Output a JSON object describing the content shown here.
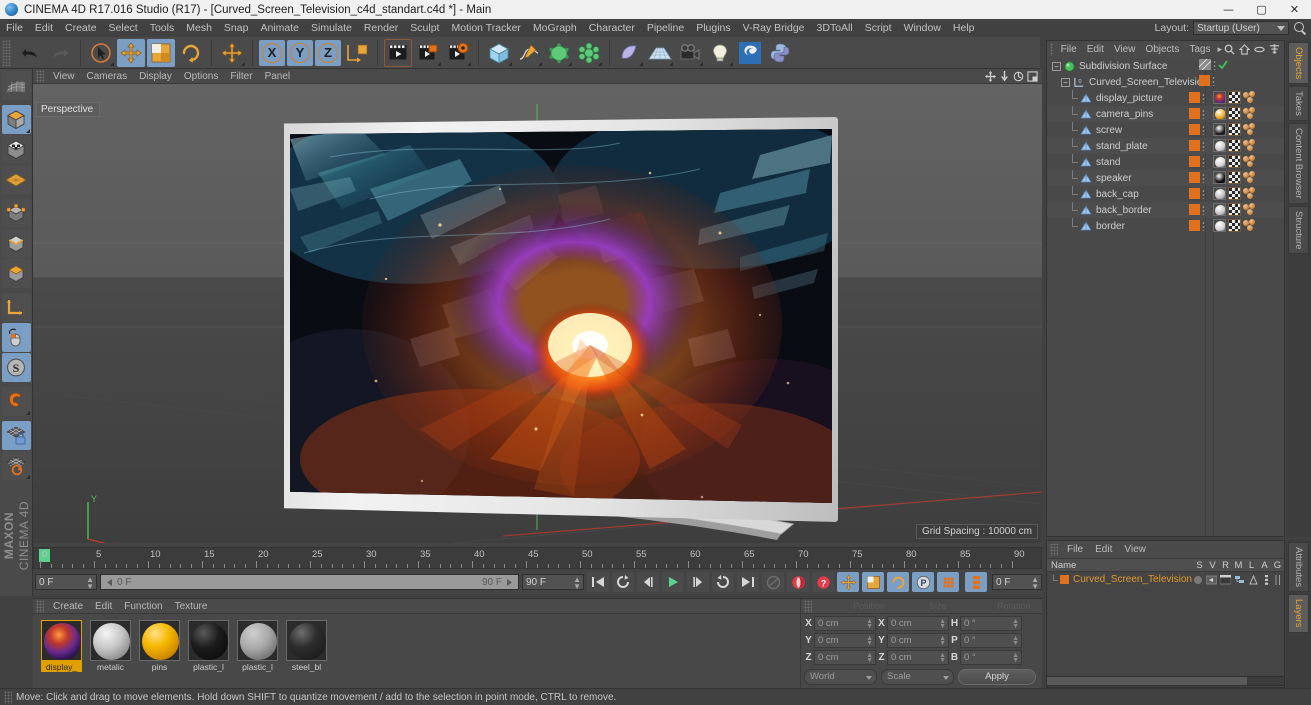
{
  "window": {
    "title": "CINEMA 4D R17.016 Studio (R17) - [Curved_Screen_Television_c4d_standart.c4d *] - Main",
    "minimize": "—",
    "maximize": "▢",
    "close": "✕"
  },
  "menubar": {
    "items": [
      "File",
      "Edit",
      "Create",
      "Select",
      "Tools",
      "Mesh",
      "Snap",
      "Animate",
      "Simulate",
      "Render",
      "Sculpt",
      "Motion Tracker",
      "MoGraph",
      "Character",
      "Pipeline",
      "Plugins",
      "V-Ray Bridge",
      "3DToAll",
      "Script",
      "Window",
      "Help"
    ],
    "layout_label": "Layout:",
    "layout_value": "Startup (User)"
  },
  "toolbar": {
    "undo": "Undo",
    "redo": "Redo",
    "live_selection": "Live Selection",
    "move": "Move",
    "scale": "Scale",
    "rotate": "Rotate",
    "move_plus": "Move Axis",
    "axis_x": "X",
    "axis_y": "Y",
    "axis_z": "Z",
    "world_coord": "World / Object Coordinate System",
    "render_view": "Render View",
    "render_region": "Render to Picture Viewer",
    "render_settings": "Edit Render Settings",
    "cube": "Add Cube Object",
    "spline": "Add Spline",
    "array": "Add Array Object",
    "mograph": "MoGraph Cloner",
    "deformer": "Add Bend Deformer",
    "floor": "Add Floor / Environment",
    "camera": "Add Camera",
    "light": "Add Light",
    "content_browser": "Content Browser",
    "python": "Script Manager"
  },
  "left_palette": {
    "items": [
      {
        "name": "make-editable-icon",
        "label": "Make Editable"
      },
      {
        "name": "model-mode-icon",
        "label": "Model Mode",
        "selected": true
      },
      {
        "name": "texture-mode-icon",
        "label": "Texture Mode"
      },
      {
        "name": "workplane-icon",
        "label": "Workplane"
      },
      {
        "name": "points-mode-icon",
        "label": "Points"
      },
      {
        "name": "edges-mode-icon",
        "label": "Edges"
      },
      {
        "name": "polygons-mode-icon",
        "label": "Polygons"
      },
      {
        "name": "object-axis-icon",
        "label": "Enable Axis Modification"
      },
      {
        "name": "viewport-solo-icon",
        "label": "Enable Snapping"
      },
      {
        "name": "soft-selection-icon",
        "label": "Soft Selection"
      },
      {
        "name": "magnet-icon",
        "label": "Magnet Tool"
      },
      {
        "name": "lock-workplane-icon",
        "label": "Lock Workplane",
        "selected": true
      },
      {
        "name": "planar-workplane-icon",
        "label": "Workplane Rotate"
      }
    ],
    "brand_line1": "MAXON",
    "brand_line2": "CINEMA 4D"
  },
  "viewport": {
    "menu": [
      "View",
      "Cameras",
      "Display",
      "Options",
      "Filter",
      "Panel"
    ],
    "camera_tag": "Perspective",
    "grid_spacing": "Grid Spacing : 10000 cm",
    "corner_icons": [
      "pan-icon",
      "dolly-icon",
      "orbit-icon",
      "maximize-viewport-icon"
    ],
    "axis_labels": {
      "y": "Y",
      "x": "X"
    },
    "scene_object": "Curved Screen Television"
  },
  "timeline": {
    "ticks": [
      0,
      5,
      10,
      15,
      20,
      25,
      30,
      35,
      40,
      45,
      50,
      55,
      60,
      65,
      70,
      75,
      80,
      85,
      90
    ],
    "current_frame": "0 F",
    "start_frame": "0 F",
    "end_frame": "90 F",
    "preview_end": "90 F",
    "range_end_field": "90 F",
    "right_frame_field": "0 F",
    "transport": [
      {
        "name": "go-to-start-button",
        "glyph": "start"
      },
      {
        "name": "play-backwards-button",
        "glyph": "loopback"
      },
      {
        "name": "step-back-button",
        "glyph": "prevframe"
      },
      {
        "name": "play-button",
        "glyph": "play"
      },
      {
        "name": "step-forward-button",
        "glyph": "nextframe"
      },
      {
        "name": "loop-button",
        "glyph": "loop"
      },
      {
        "name": "go-to-end-button",
        "glyph": "end"
      },
      {
        "name": "autokey-toggle-button",
        "glyph": "autokey"
      },
      {
        "name": "record-active-objects-button",
        "glyph": "record"
      },
      {
        "name": "key-selection-button",
        "glyph": "question"
      },
      {
        "name": "position-key-button",
        "glyph": "move"
      },
      {
        "name": "scale-key-button",
        "glyph": "scale"
      },
      {
        "name": "rotation-key-button",
        "glyph": "rotate"
      },
      {
        "name": "parameter-key-button",
        "glyph": "param"
      },
      {
        "name": "pla-key-button",
        "glyph": "pla"
      },
      {
        "name": "keyframe-selection-button",
        "glyph": "keysel"
      }
    ]
  },
  "material_manager": {
    "menu": [
      "Create",
      "Edit",
      "Function",
      "Texture"
    ],
    "materials": [
      {
        "name": "display_picture",
        "label": "display_",
        "selected": true,
        "color": "display"
      },
      {
        "name": "metalic",
        "label": "metalic",
        "selected": false,
        "color": "#b8b8b8"
      },
      {
        "name": "pins",
        "label": "pins",
        "selected": false,
        "color": "#f0a81c"
      },
      {
        "name": "plastic_black",
        "label": "plastic_l",
        "selected": false,
        "color": "#111111"
      },
      {
        "name": "plastic_light",
        "label": "plastic_l",
        "selected": false,
        "color": "#9d9d9d"
      },
      {
        "name": "steel_black",
        "label": "steel_bl",
        "selected": false,
        "color": "#2a2a2a"
      }
    ]
  },
  "coordinates": {
    "headers": [
      "Position",
      "Size",
      "Rotation"
    ],
    "rows": [
      {
        "pos_label": "X",
        "pos_value": "0 cm",
        "size_label": "X",
        "size_value": "0 cm",
        "rot_label": "H",
        "rot_value": "0 °"
      },
      {
        "pos_label": "Y",
        "pos_value": "0 cm",
        "size_label": "Y",
        "size_value": "0 cm",
        "rot_label": "P",
        "rot_value": "0 °"
      },
      {
        "pos_label": "Z",
        "pos_value": "0 cm",
        "size_label": "Z",
        "size_value": "0 cm",
        "rot_label": "B",
        "rot_value": "0 °"
      }
    ],
    "system": "World",
    "mode": "Scale",
    "apply": "Apply"
  },
  "object_manager": {
    "menu": [
      "File",
      "Edit",
      "View",
      "Objects",
      "Tags"
    ],
    "more": "▸",
    "header_icons": [
      "search-icon",
      "home-icon",
      "link-icon",
      "filter-icon"
    ],
    "tree": [
      {
        "label": "Subdivision Surface",
        "depth": 0,
        "icon": "subdivision-surface-icon",
        "has_expander": true,
        "tags": [
          "hatch",
          "check"
        ]
      },
      {
        "label": "Curved_Screen_Television",
        "depth": 1,
        "icon": "null-object-icon",
        "has_expander": true,
        "tags": []
      },
      {
        "label": "display_picture",
        "depth": 2,
        "icon": "polygon-object-icon",
        "material": "display",
        "tags": [
          "mat",
          "tex",
          "sel"
        ]
      },
      {
        "label": "camera_pins",
        "depth": 2,
        "icon": "polygon-object-icon",
        "material": "#f0a81c",
        "tags": [
          "mat",
          "tex",
          "sel"
        ]
      },
      {
        "label": "screw",
        "depth": 2,
        "icon": "polygon-object-icon",
        "material": "#1a1a1a",
        "tags": [
          "mat",
          "tex",
          "sel"
        ]
      },
      {
        "label": "stand_plate",
        "depth": 2,
        "icon": "polygon-object-icon",
        "material": "#c9c9c9",
        "tags": [
          "mat",
          "tex",
          "sel"
        ]
      },
      {
        "label": "stand",
        "depth": 2,
        "icon": "polygon-object-icon",
        "material": "#d4d4d4",
        "tags": [
          "mat",
          "tex",
          "sel"
        ]
      },
      {
        "label": "speaker",
        "depth": 2,
        "icon": "polygon-object-icon",
        "material": "#0d0d0d",
        "tags": [
          "mat",
          "tex",
          "sel"
        ]
      },
      {
        "label": "back_cap",
        "depth": 2,
        "icon": "polygon-object-icon",
        "material": "#bdbdbd",
        "tags": [
          "mat",
          "tex",
          "sel"
        ]
      },
      {
        "label": "back_border",
        "depth": 2,
        "icon": "polygon-object-icon",
        "material": "#c4c4c4",
        "tags": [
          "mat",
          "tex",
          "sel"
        ]
      },
      {
        "label": "border",
        "depth": 2,
        "icon": "polygon-object-icon",
        "material": "#d0d0d0",
        "tags": [
          "mat",
          "tex",
          "sel"
        ]
      }
    ]
  },
  "layers_panel": {
    "menu": [
      "File",
      "Edit",
      "View"
    ],
    "columns": [
      "Name",
      "S",
      "V",
      "R",
      "M",
      "L",
      "A",
      "G"
    ],
    "rows": [
      {
        "label": "Curved_Screen_Television",
        "color": "#e2711d"
      }
    ]
  },
  "right_tabs_top": [
    "Objects",
    "Takes",
    "Content Browser",
    "Structure"
  ],
  "right_tabs_bottom": [
    "Attributes",
    "Layers"
  ],
  "statusbar": {
    "message": "Move: Click and drag to move elements. Hold down SHIFT to quantize movement / add to the selection in point mode, CTRL to remove."
  },
  "colors": {
    "accent_orange": "#e2711d",
    "selection_blue": "#7a9ec4",
    "panel_bg": "#454545",
    "toolbar_bg": "#4a4a4a",
    "titlebar_bg": "#f0f0f0",
    "active_tab_text": "#e8a735",
    "play_green": "#5cd18e"
  }
}
